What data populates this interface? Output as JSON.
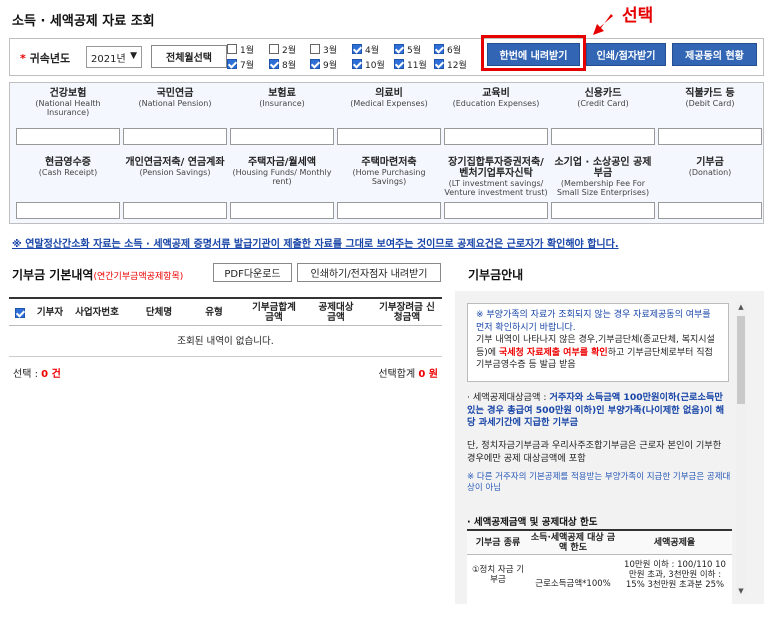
{
  "page": {
    "title": "소득 · 세액공제 자료 조회"
  },
  "annotation": {
    "text": "선택",
    "color": "#e60000"
  },
  "filter": {
    "year_label": "귀속년도",
    "required_mark": "*",
    "year_value": "2021년",
    "all_month_label": "전체월선택",
    "months": [
      {
        "label": "1월",
        "checked": false
      },
      {
        "label": "7월",
        "checked": true
      },
      {
        "label": "2월",
        "checked": false
      },
      {
        "label": "8월",
        "checked": true
      },
      {
        "label": "3월",
        "checked": false
      },
      {
        "label": "9월",
        "checked": true
      },
      {
        "label": "4월",
        "checked": true
      },
      {
        "label": "10월",
        "checked": true
      },
      {
        "label": "5월",
        "checked": true
      },
      {
        "label": "11월",
        "checked": true
      },
      {
        "label": "6월",
        "checked": true
      },
      {
        "label": "12월",
        "checked": true
      }
    ]
  },
  "actions": {
    "download_all": "한번에 내려받기",
    "print_submit": "인쇄/점자받기",
    "provider_status": "제공동의 현황",
    "accent_color": "#3266b5"
  },
  "categories": [
    {
      "title": "건강보험",
      "sub": "(National Health Insurance)"
    },
    {
      "title": "국민연금",
      "sub": "(National Pension)"
    },
    {
      "title": "보험료",
      "sub": "(Insurance)"
    },
    {
      "title": "의료비",
      "sub": "(Medical Expenses)"
    },
    {
      "title": "교육비",
      "sub": "(Education Expenses)"
    },
    {
      "title": "신용카드",
      "sub": "(Credit Card)"
    },
    {
      "title": "직불카드 등",
      "sub": "(Debit Card)"
    },
    {
      "title": "현금영수증",
      "sub": "(Cash Receipt)"
    },
    {
      "title": "개인연금저축/ 연금계좌",
      "sub": "(Pension Savings)"
    },
    {
      "title": "주택자금/월세액",
      "sub": "(Housing Funds/ Monthly rent)"
    },
    {
      "title": "주택마련저축",
      "sub": "(Home Purchasing Savings)"
    },
    {
      "title": "장기집합투자증권저축/ 벤처기업투자신탁",
      "sub": "(LT investment savings/ Venture investment trust)"
    },
    {
      "title": "소기업 · 소상공인 공제부금",
      "sub": "(Membership Fee For Small Size Enterprises)"
    },
    {
      "title": "기부금",
      "sub": "(Donation)"
    }
  ],
  "notice": "※ 연말정산간소화 자료는 소득 · 세액공제 증명서류 발급기관이 제출한 자료를 그대로 보여주는 것이므로 공제요건은 근로자가 확인해야 합니다.",
  "donation": {
    "title": "기부금 기본내역",
    "title_note": "(연간기부금액공제항목)",
    "pdf_btn": "PDF다운로드",
    "print_btn": "인쇄하기/전자점자 내려받기",
    "columns": [
      "기부자",
      "사업자번호",
      "단체명",
      "유형",
      "기부금합계 금액",
      "공제대상 금액",
      "기부장려금 신청금액"
    ],
    "empty_text": "조회된 내역이 없습니다.",
    "selected_label": "선택 :",
    "selected_count": "0 건",
    "selected_total_label": "선택합계",
    "selected_total": "0 원"
  },
  "guide": {
    "title": "기부금안내",
    "box_line1": "※ 부양가족의 자료가 조회되지 않는 경우 자료제공동의 여부를 먼저 확인하시기 바랍니다.",
    "box_line2_a": "기부 내역이 나타나지 않은 경우,기부금단체(종교단체, 복지시설 등)에",
    "box_line2_red": "국세청 자료제출 여부를 확인",
    "box_line2_b": "하고 기부금단체로부터 직접 기부금영수증 등 발급 받음",
    "para1_a": "· 세액공제대상금액 :",
    "para1_b": "거주자와 소득금액 100만원이하(근로소득만 있는 경우 총급여 500만원 이하)인 부양가족(나이제한 없음)이 해당 과세기간에 지급한 기부금",
    "para1_c": "단, 정치자금기부금과 우리사주조합기부금은 근로자 본인이 기부한 경우에만 공제 대상금액에 포함",
    "note": "※ 다른 거주자의 기본공제를 적용받는 부양가족이 지급한 기부금은 공제대상이 아님",
    "limits_title": "· 세액공제금액 및 공제대상 한도",
    "limits_cols": [
      "기부금 종류",
      "소득·세액공제 대상 금액 한도",
      "세액공제율"
    ],
    "limits_row_type": "①정치 자금 기부금",
    "limits_row_limit": "근로소득금액*100%",
    "limits_row_rate": "10만원 이하 : 100/110 10만원 초과, 3천만원 이하 : 15% 3천만원 초과분 25%"
  }
}
